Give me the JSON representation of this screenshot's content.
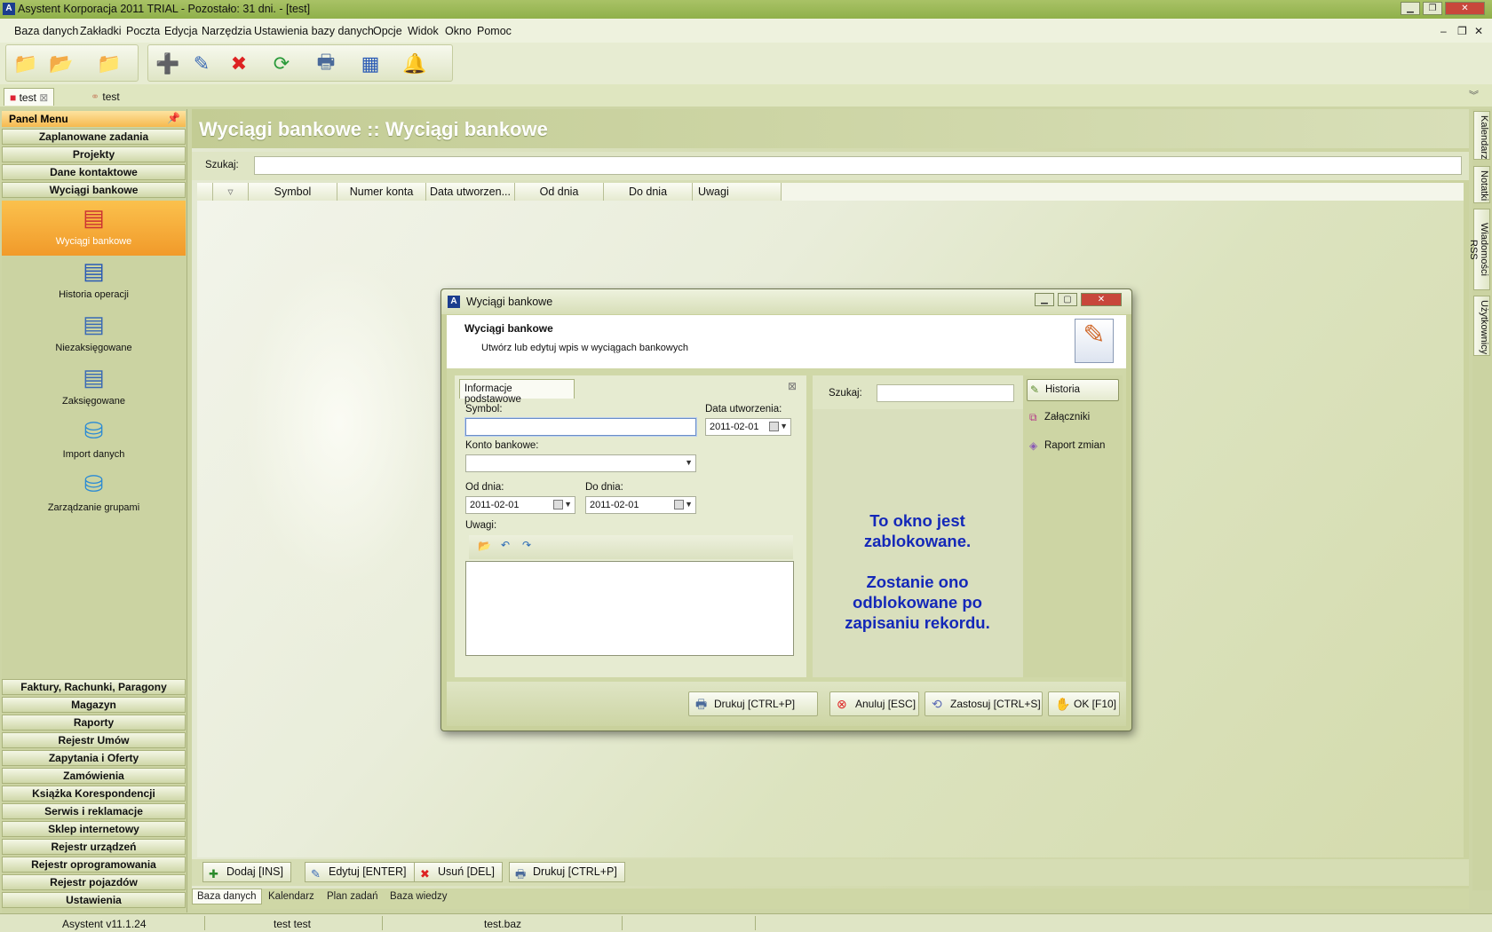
{
  "window": {
    "title": "Asystent Korporacja 2011 TRIAL - Pozostało: 31 dni. - [test]",
    "app_icon": "A"
  },
  "menu": [
    "Baza danych",
    "Zakładki",
    "Poczta",
    "Edycja",
    "Narzędzia",
    "Ustawienia bazy danych",
    "Opcje",
    "Widok",
    "Okno",
    "Pomoc"
  ],
  "doc_tabs": [
    "test",
    "test"
  ],
  "panel_menu": {
    "title": "Panel Menu",
    "top_buttons": [
      "Zaplanowane zadania",
      "Projekty",
      "Dane kontaktowe",
      "Wyciągi bankowe"
    ],
    "items": [
      "Wyciągi bankowe",
      "Historia operacji",
      "Niezaksięgowane",
      "Zaksięgowane",
      "Import danych",
      "Zarządzanie grupami"
    ],
    "bottom_buttons": [
      "Faktury, Rachunki, Paragony",
      "Magazyn",
      "Raporty",
      "Rejestr Umów",
      "Zapytania i Oferty",
      "Zamówienia",
      "Książka Korespondencji",
      "Serwis i reklamacje",
      "Sklep internetowy",
      "Rejestr urządzeń",
      "Rejestr oprogramowania",
      "Rejestr pojazdów",
      "Ustawienia"
    ]
  },
  "main": {
    "title": "Wyciągi bankowe :: Wyciągi bankowe",
    "search_label": "Szukaj:",
    "columns": [
      "Symbol",
      "Numer konta",
      "Data utworzen...",
      "Od dnia",
      "Do dnia",
      "Uwagi"
    ],
    "actions": [
      "Dodaj [INS]",
      "Edytuj [ENTER]",
      "Usuń [DEL]",
      "Drukuj [CTRL+P]"
    ],
    "bottom_tabs": [
      "Baza danych",
      "Kalendarz",
      "Plan zadań",
      "Baza wiedzy"
    ]
  },
  "right_tabs": [
    "Kalendarz",
    "Notatki",
    "Wiadomości RSS",
    "Użytkownicy"
  ],
  "status": {
    "version": "Asystent v11.1.24",
    "user": "test test",
    "file": "test.baz"
  },
  "dialog": {
    "title": "Wyciągi bankowe",
    "header_title": "Wyciągi bankowe",
    "header_subtitle": "Utwórz lub edytuj wpis w wyciągach bankowych",
    "tab": "Informacje podstawowe",
    "symbol_label": "Symbol:",
    "symbol_value": "",
    "created_label": "Data utworzenia:",
    "created_value": "2011-02-01",
    "account_label": "Konto bankowe:",
    "account_value": "",
    "from_label": "Od dnia:",
    "from_value": "2011-02-01",
    "to_label": "Do dnia:",
    "to_value": "2011-02-01",
    "notes_label": "Uwagi:",
    "notes_value": "",
    "search_label": "Szukaj:",
    "locked_1": "To okno jest zablokowane.",
    "locked_2": "Zostanie ono odblokowane po zapisaniu rekordu.",
    "side": [
      "Historia",
      "Załączniki",
      "Raport zmian"
    ],
    "buttons": [
      "Drukuj [CTRL+P]",
      "Anuluj [ESC]",
      "Zastosuj [CTRL+S]",
      "OK [F10]"
    ]
  }
}
